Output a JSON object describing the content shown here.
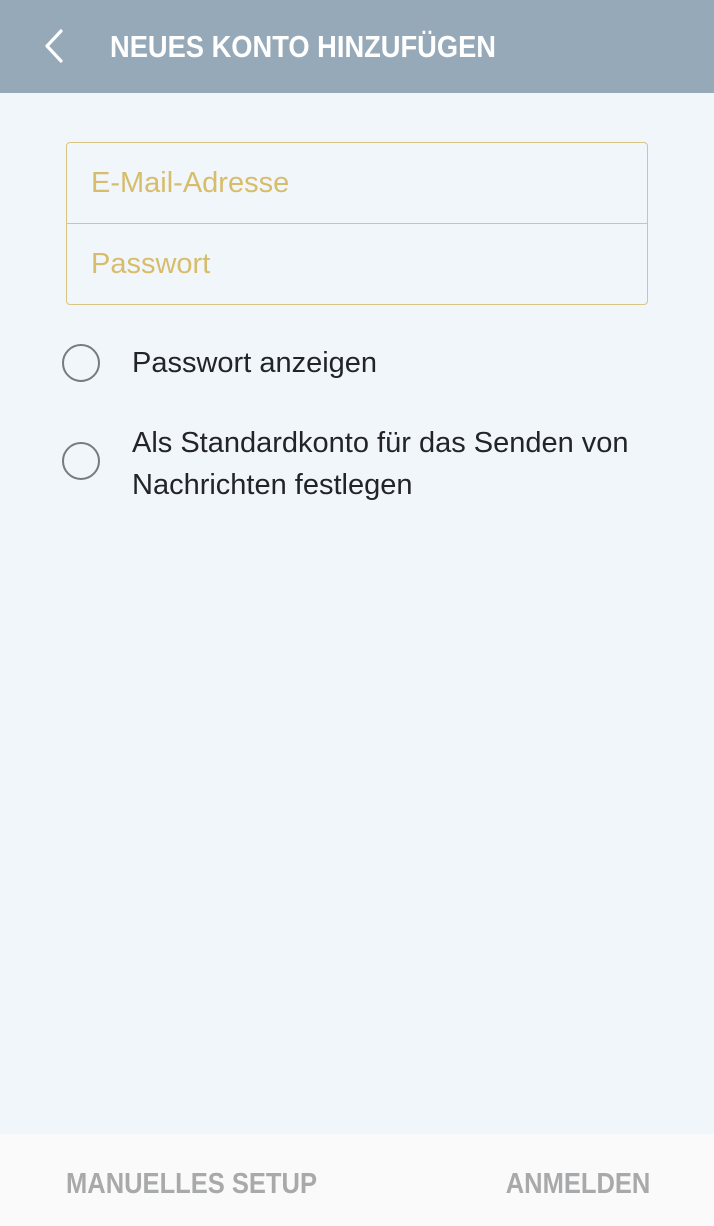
{
  "header": {
    "back_icon": "chevron-left-icon",
    "title": "NEUES KONTO HINZUFÜGEN"
  },
  "form": {
    "email_placeholder": "E-Mail-Adresse",
    "email_value": "",
    "password_placeholder": "Passwort",
    "password_value": ""
  },
  "options": [
    {
      "label": "Passwort anzeigen",
      "checked": false
    },
    {
      "label": "Als Standardkonto für das Senden von Nachrichten festlegen",
      "checked": false
    }
  ],
  "footer": {
    "manual_setup_label": "MANUELLES SETUP",
    "login_label": "ANMELDEN"
  },
  "colors": {
    "header_bg": "#96a9b9",
    "page_bg": "#f1f6fa",
    "accent": "#d7bd6b",
    "disabled_text": "#a8a9aa"
  }
}
